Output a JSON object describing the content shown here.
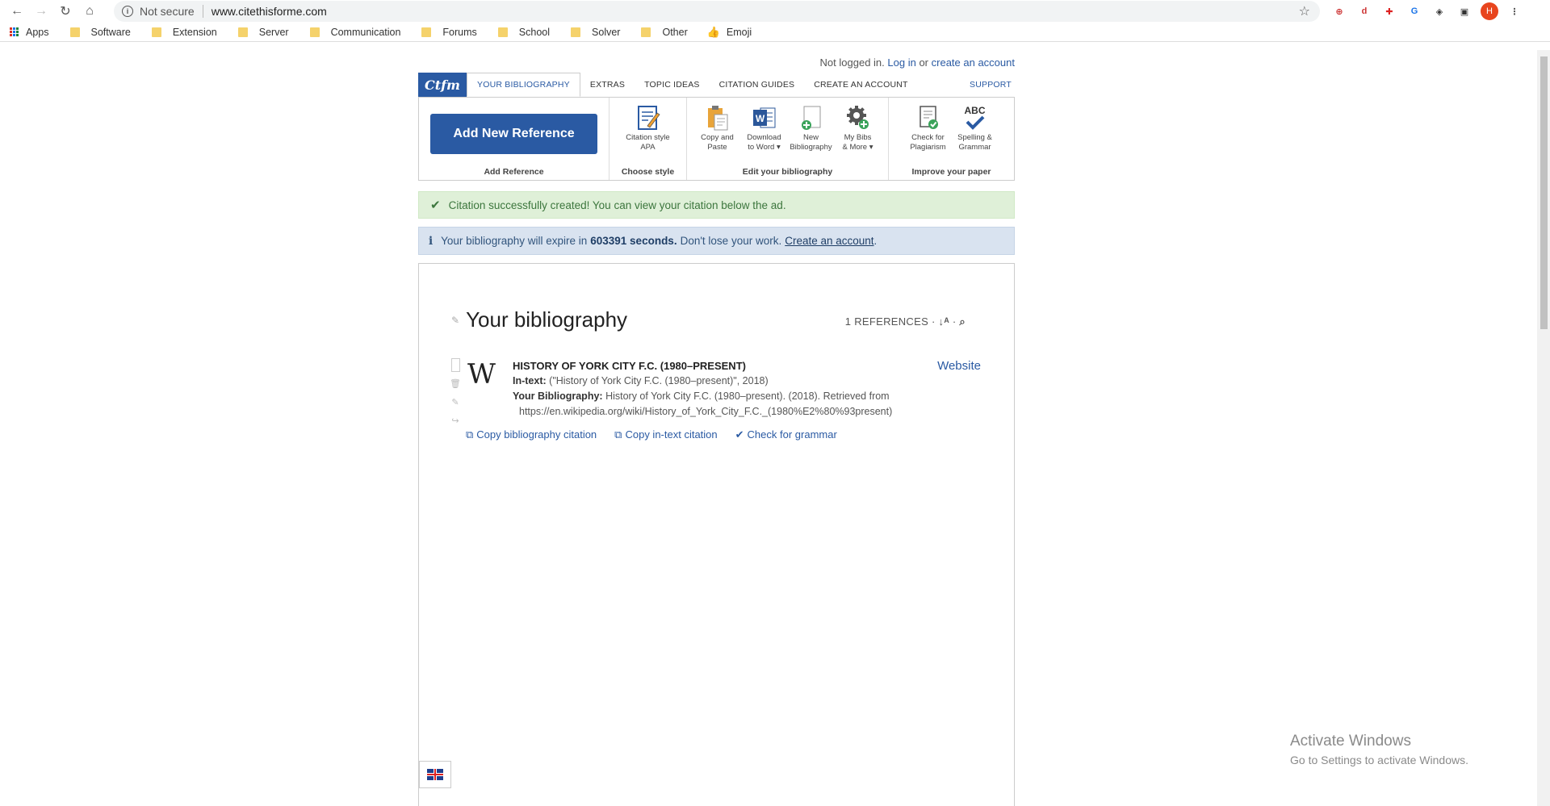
{
  "browser": {
    "omnibox": {
      "security_label": "Not secure",
      "url": "www.citethisforme.com"
    },
    "avatar_initial": "H",
    "bookmarks": [
      "Apps",
      "Software",
      "Extension",
      "Server",
      "Communication",
      "Forums",
      "School",
      "Solver",
      "Other",
      "Emoji"
    ]
  },
  "header": {
    "login_prefix": "Not logged in.",
    "login_link": "Log in",
    "login_or": "or",
    "create_link": "create an account"
  },
  "nav": {
    "logo": "Ctfm",
    "tabs": [
      "YOUR BIBLIOGRAPHY",
      "EXTRAS",
      "TOPIC IDEAS",
      "CITATION GUIDES",
      "CREATE AN ACCOUNT"
    ],
    "support": "SUPPORT"
  },
  "toolbar": {
    "add_button": "Add New Reference",
    "add_label": "Add Reference",
    "style_label": "Choose style",
    "citation_style_line1": "Citation style",
    "citation_style_line2": "APA",
    "edit_label": "Edit your bibliography",
    "copy_paste_1": "Copy and",
    "copy_paste_2": "Paste",
    "download_1": "Download",
    "download_2": "to Word",
    "new_bib_1": "New",
    "new_bib_2": "Bibliography",
    "my_bibs_1": "My Bibs",
    "my_bibs_2": "& More",
    "improve_label": "Improve your paper",
    "plag_1": "Check for",
    "plag_2": "Plagiarism",
    "spell_1": "Spelling &",
    "spell_2": "Grammar",
    "spell_icon_text": "ABC"
  },
  "alerts": {
    "success": "Citation successfully created! You can view your citation below the ad.",
    "info_prefix": "Your bibliography will expire in",
    "info_seconds": "603391 seconds.",
    "info_middle": "Don't lose your work.",
    "info_link": "Create an account",
    "info_suffix": "."
  },
  "bibliography": {
    "title": "Your bibliography",
    "ref_count": "1 REFERENCES ·",
    "entries": [
      {
        "title": "HISTORY OF YORK CITY F.C. (1980–PRESENT)",
        "type": "Website",
        "intext_label": "In-text:",
        "intext": "(\"History of York City F.C. (1980–present)\", 2018)",
        "bib_label": "Your Bibliography:",
        "bib": "History of York City F.C. (1980–present). (2018). Retrieved from",
        "url": "https://en.wikipedia.org/wiki/History_of_York_City_F.C._(1980%E2%80%93present)",
        "logo": "W"
      }
    ],
    "actions": [
      "Copy bibliography citation",
      "Copy in-text citation",
      "Check for grammar"
    ]
  },
  "watermark": {
    "line1": "Activate Windows",
    "line2": "Go to Settings to activate Windows."
  },
  "colors": {
    "brand": "#2a5aa3",
    "success_bg": "#dff0d8",
    "info_bg": "#d9e3f0"
  }
}
